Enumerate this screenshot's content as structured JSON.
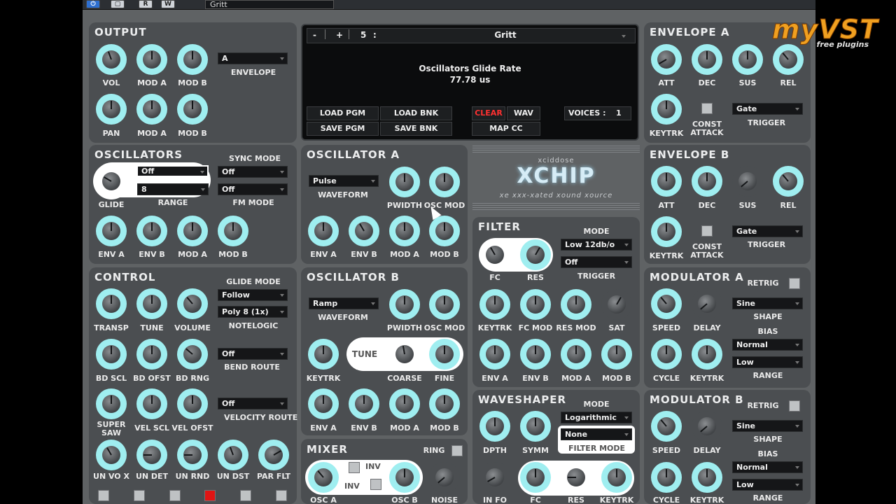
{
  "host": {
    "preset": "Gritt",
    "buttons": {
      "power": "⏻",
      "b2": "▢",
      "r": "R",
      "w": "W"
    }
  },
  "display": {
    "minus": "-",
    "plus": "+",
    "program_num": "5",
    "colon": ":",
    "program_name": "Gritt",
    "param_name": "Oscillators Glide Rate",
    "param_value": "77.78 us",
    "load_pgm": "LOAD PGM",
    "save_pgm": "SAVE PGM",
    "load_bnk": "LOAD BNK",
    "save_bnk": "SAVE BNK",
    "clear": "CLEAR",
    "wav": "WAV",
    "map_cc": "MAP CC",
    "voices_label": "VOICES :",
    "voices_value": "1"
  },
  "logo": {
    "top": "xciddose",
    "name": "XCHIP",
    "tagline": "xe xxx-xated xound xource"
  },
  "watermark": {
    "main": "myVST",
    "sub": "free plugins"
  },
  "output": {
    "title": "OUTPUT",
    "vol": "VOL",
    "mod_a": "MOD A",
    "mod_b": "MOD B",
    "pan": "PAN",
    "mod_a2": "MOD A",
    "mod_b2": "MOD B",
    "envelope_value": "A",
    "envelope_label": "ENVELOPE"
  },
  "oscillators": {
    "title": "OSCILLATORS",
    "glide": "GLIDE",
    "range_label": "RANGE",
    "glide_value": "Off",
    "range_value": "8",
    "sync_mode_label": "SYNC MODE",
    "sync_value": "Off",
    "fm_value": "Off",
    "fm_mode_label": "FM MODE",
    "env_a": "ENV A",
    "env_b": "ENV B",
    "mod_a": "MOD A",
    "mod_b": "MOD B"
  },
  "control": {
    "title": "CONTROL",
    "transp": "TRANSP",
    "tune": "TUNE",
    "volume": "VOLUME",
    "glide_mode_label": "GLIDE MODE",
    "glide_mode_value": "Follow",
    "notelogic_value": "Poly 8 (1x)",
    "notelogic_label": "NOTELOGIC",
    "bd_scl": "BD SCL",
    "bd_ofst": "BD OFST",
    "bd_rng": "BD RNG",
    "bend_route_value": "Off",
    "bend_route_label": "BEND ROUTE",
    "super_saw": "SUPER SAW",
    "vel_scl": "VEL SCL",
    "vel_ofst": "VEL OFST",
    "velocity_route_value": "Off",
    "velocity_route_label": "VELOCITY ROUTE",
    "un_vo_x": "UN VO X",
    "un_det": "UN DET",
    "un_rnd": "UN RND",
    "un_dst": "UN DST",
    "par_flt": "PAR FLT"
  },
  "osc_a": {
    "title": "OSCILLATOR A",
    "waveform_value": "Pulse",
    "waveform_label": "WAVEFORM",
    "pwidth": "PWIDTH",
    "osc_mod": "OSC MOD",
    "env_a": "ENV A",
    "env_b": "ENV B",
    "mod_a": "MOD A",
    "mod_b": "MOD B"
  },
  "osc_b": {
    "title": "OSCILLATOR B",
    "waveform_value": "Ramp",
    "waveform_label": "WAVEFORM",
    "pwidth": "PWIDTH",
    "osc_mod": "OSC MOD",
    "keytrk": "KEYTRK",
    "tune": "TUNE",
    "coarse": "COARSE",
    "fine": "FINE",
    "env_a": "ENV A",
    "env_b": "ENV B",
    "mod_a": "MOD A",
    "mod_b": "MOD B"
  },
  "mixer": {
    "title": "MIXER",
    "ring": "RING",
    "inv1": "INV",
    "inv2": "INV",
    "osc_a": "OSC A",
    "osc_b": "OSC B",
    "noise": "NOISE"
  },
  "filter": {
    "title": "FILTER",
    "fc": "FC",
    "res": "RES",
    "mode_label": "MODE",
    "mode_value": "Low 12db/o",
    "trigger_value": "Off",
    "trigger_label": "TRIGGER",
    "keytrk": "KEYTRK",
    "fc_mod": "FC MOD",
    "res_mod": "RES MOD",
    "sat": "SAT",
    "env_a": "ENV A",
    "env_b": "ENV B",
    "mod_a": "MOD A",
    "mod_b": "MOD B"
  },
  "waveshaper": {
    "title": "WAVESHAPER",
    "mode_label": "MODE",
    "mode_value": "Logarithmic",
    "filter_mode_value": "None",
    "filter_mode_label": "FILTER MODE",
    "dpth": "DPTH",
    "symm": "SYMM",
    "in_fo": "IN FO",
    "fc": "FC",
    "res": "RES",
    "keytrk": "KEYTRK"
  },
  "env_a": {
    "title": "ENVELOPE A",
    "att": "ATT",
    "dec": "DEC",
    "sus": "SUS",
    "rel": "REL",
    "keytrk": "KEYTRK",
    "const_attack": "CONST ATTACK",
    "trigger_value": "Gate",
    "trigger_label": "TRIGGER"
  },
  "env_b": {
    "title": "ENVELOPE B",
    "att": "ATT",
    "dec": "DEC",
    "sus": "SUS",
    "rel": "REL",
    "keytrk": "KEYTRK",
    "const_attack": "CONST ATTACK",
    "trigger_value": "Gate",
    "trigger_label": "TRIGGER"
  },
  "mod_a": {
    "title": "MODULATOR A",
    "retrig": "RETRIG",
    "speed": "SPEED",
    "delay": "DELAY",
    "shape_value": "Sine",
    "shape_label": "SHAPE",
    "bias_label": "BIAS",
    "bias_value": "Normal",
    "range_value": "Low",
    "range_label": "RANGE",
    "cycle": "CYCLE",
    "keytrk": "KEYTRK"
  },
  "mod_b": {
    "title": "MODULATOR B",
    "retrig": "RETRIG",
    "speed": "SPEED",
    "delay": "DELAY",
    "shape_value": "Sine",
    "shape_label": "SHAPE",
    "bias_label": "BIAS",
    "bias_value": "Normal",
    "range_value": "Low",
    "range_label": "RANGE",
    "cycle": "CYCLE",
    "keytrk": "KEYTRK"
  },
  "colors": {
    "knob_ring": "#9feef0",
    "panel": "#4b4e51",
    "background": "#5f6264",
    "clear": "#ff3030",
    "watermark": "#f0a020"
  }
}
